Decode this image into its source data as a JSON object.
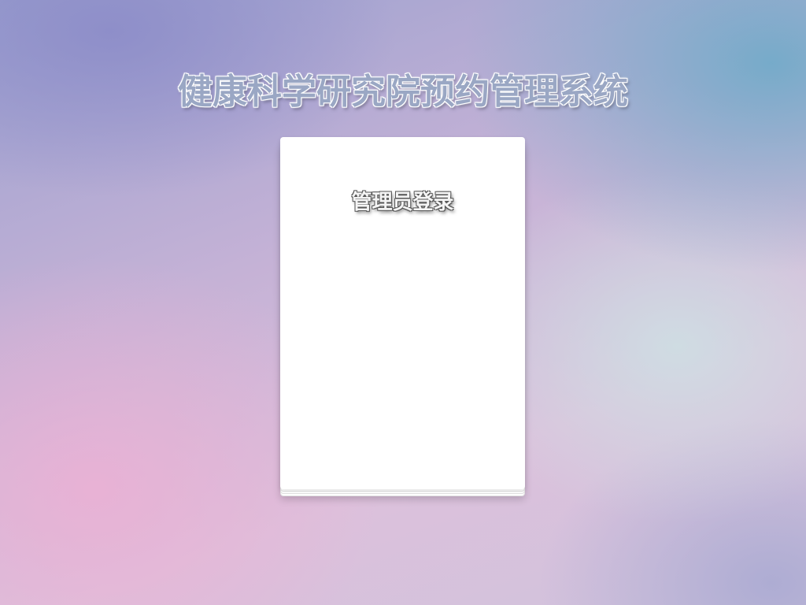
{
  "header": {
    "system_title": "健康科学研究院预约管理系统"
  },
  "login_card": {
    "title": "管理员登录"
  }
}
